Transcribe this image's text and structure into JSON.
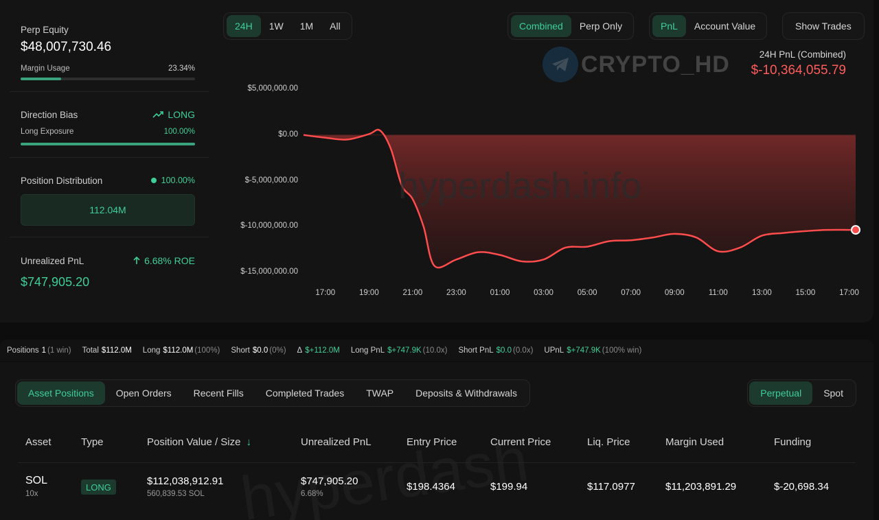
{
  "summary": {
    "perp_equity_label": "Perp Equity",
    "perp_equity_value": "$48,007,730.46",
    "margin_usage_label": "Margin Usage",
    "margin_usage_value": "23.34%",
    "margin_usage_fraction": 0.2334,
    "direction_bias_label": "Direction Bias",
    "direction_bias_value": "LONG",
    "long_exposure_label": "Long Exposure",
    "long_exposure_value": "100.00%",
    "long_exposure_fraction": 1.0,
    "position_distribution_label": "Position Distribution",
    "position_distribution_pct": "100.00%",
    "position_distribution_amount": "112.04M",
    "unrealized_pnl_label": "Unrealized PnL",
    "unrealized_pnl_roe": "6.68% ROE",
    "unrealized_pnl_value": "$747,905.20"
  },
  "range_buttons": [
    "24H",
    "1W",
    "1M",
    "All"
  ],
  "range_active": "24H",
  "mode_buttons": [
    "Combined",
    "Perp Only"
  ],
  "metric_buttons": [
    "PnL",
    "Account Value"
  ],
  "show_trades_label": "Show Trades",
  "pnl_summary": {
    "label": "24H PnL (Combined)",
    "value": "$-10,364,055.79"
  },
  "watermarks": {
    "telegram": "CRYPTO_HD",
    "site": "hyperdash.info"
  },
  "colors": {
    "green": "#3ecf98",
    "red": "#ff5c5c",
    "panel": "#141414"
  },
  "chart_data": {
    "type": "area",
    "x_ticks": [
      "17:00",
      "19:00",
      "21:00",
      "23:00",
      "01:00",
      "03:00",
      "05:00",
      "07:00",
      "09:00",
      "11:00",
      "13:00",
      "15:00",
      "17:00"
    ],
    "y_ticks": [
      "$5,000,000.00",
      "$0.00",
      "$-5,000,000.00",
      "$-10,000,000.00",
      "$-15,000,000.00"
    ],
    "y_tick_values": [
      5000000,
      0,
      -5000000,
      -10000000,
      -15000000
    ],
    "ylim": [
      -15000000,
      5000000
    ],
    "x_hours": [
      0,
      1,
      2,
      3,
      3.5,
      4,
      4.5,
      5,
      5.5,
      6,
      7,
      8,
      9,
      10,
      11,
      12,
      13,
      14,
      15,
      16,
      17,
      18,
      19,
      20,
      21,
      22,
      23,
      24,
      25.3
    ],
    "y": [
      0,
      -300000,
      -500000,
      100000,
      500000,
      -1500000,
      -5500000,
      -7000000,
      -10000000,
      -14300000,
      -13600000,
      -12800000,
      -13100000,
      -13800000,
      -13600000,
      -12300000,
      -12200000,
      -11600000,
      -11500000,
      -11200000,
      -10800000,
      -11200000,
      -12700000,
      -12300000,
      -11000000,
      -10700000,
      -10500000,
      -10364055.79,
      -10364055.79
    ],
    "grid": false,
    "legend": "none"
  },
  "stats": {
    "positions_label": "Positions",
    "positions_value": "1",
    "positions_meta": "(1 win)",
    "total_label": "Total",
    "total_value": "$112.0M",
    "long_label": "Long",
    "long_value": "$112.0M",
    "long_meta": "(100%)",
    "short_label": "Short",
    "short_value": "$0.0",
    "short_meta": "(0%)",
    "delta_label": "Δ",
    "delta_value": "$+112.0M",
    "long_pnl_label": "Long PnL",
    "long_pnl_value": "$+747.9K",
    "long_pnl_meta": "(10.0x)",
    "short_pnl_label": "Short PnL",
    "short_pnl_value": "$0.0",
    "short_pnl_meta": "(0.0x)",
    "upnl_label": "UPnL",
    "upnl_value": "$+747.9K",
    "upnl_meta": "(100% win)"
  },
  "tabs": [
    "Asset Positions",
    "Open Orders",
    "Recent Fills",
    "Completed Trades",
    "TWAP",
    "Deposits & Withdrawals"
  ],
  "tab_active": "Asset Positions",
  "market_segments": [
    "Perpetual",
    "Spot"
  ],
  "table": {
    "headers": [
      "Asset",
      "Type",
      "Position Value / Size",
      "Unrealized PnL",
      "Entry Price",
      "Current Price",
      "Liq. Price",
      "Margin Used",
      "Funding"
    ],
    "sort_indicator": "↓",
    "rows": [
      {
        "asset": "SOL",
        "leverage": "10x",
        "type": "LONG",
        "position_value": "$112,038,912.91",
        "position_size": "560,839.53 SOL",
        "unrealized_pnl": "$747,905.20",
        "unrealized_pnl_pct": "6.68%",
        "entry_price": "$198.4364",
        "current_price": "$199.94",
        "liq_price": "$117.0977",
        "margin_used": "$11,203,891.29",
        "funding": "$-20,698.34"
      }
    ]
  }
}
